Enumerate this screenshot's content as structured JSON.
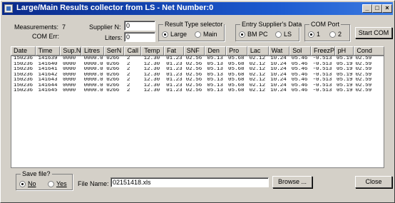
{
  "window": {
    "title": "Large/Main Results collector from LS - Net Number:0",
    "minimize_label": "_",
    "maximize_label": "□",
    "close_label": "×"
  },
  "status": {
    "measurements_label": "Measurements:",
    "measurements_value": "7",
    "com_err_label": "COM Err:"
  },
  "supplier": {
    "label": "Supplier N:",
    "value": "0"
  },
  "liters": {
    "label": "Liters:",
    "value": "0"
  },
  "result_type": {
    "title": "Result Type selector",
    "options": [
      {
        "label": "Large",
        "selected": true
      },
      {
        "label": "Main",
        "selected": false
      }
    ]
  },
  "entry_supplier": {
    "title": "Entry Supplier's Data",
    "options": [
      {
        "label": "BM PC",
        "selected": true
      },
      {
        "label": "LS",
        "selected": false
      }
    ]
  },
  "com_port": {
    "title": "COM Port",
    "options": [
      {
        "label": "1",
        "selected": true
      },
      {
        "label": "2",
        "selected": false
      }
    ]
  },
  "start_com_label": "Start COM",
  "table": {
    "columns": [
      "Date",
      "Time",
      "Sup.N:",
      "Litres",
      "SerN",
      "Call",
      "Temp",
      "Fat",
      "SNF",
      "Den",
      "Pro",
      "Lac",
      "Wat",
      "Sol",
      "FreezP",
      "pH",
      "Cond"
    ],
    "rows": [
      [
        "150236",
        "141639",
        "0000",
        "0000.0",
        "0266",
        "2",
        "12.30",
        "01.23",
        "02.56",
        "05.13",
        "05.68",
        "02.12",
        "10.24",
        "05.46",
        "-0.513",
        "05.19",
        "02.59"
      ],
      [
        "150236",
        "141640",
        "0000",
        "0000.0",
        "0266",
        "2",
        "12.30",
        "01.23",
        "02.56",
        "05.13",
        "05.68",
        "02.12",
        "10.24",
        "05.46",
        "-0.513",
        "05.19",
        "02.59"
      ],
      [
        "150236",
        "141641",
        "0000",
        "0000.0",
        "0266",
        "2",
        "12.30",
        "01.23",
        "02.56",
        "05.13",
        "05.68",
        "02.12",
        "10.24",
        "05.46",
        "-0.513",
        "05.19",
        "02.59"
      ],
      [
        "150236",
        "141642",
        "0000",
        "0000.0",
        "0266",
        "2",
        "12.30",
        "01.23",
        "02.56",
        "05.13",
        "05.68",
        "02.12",
        "10.24",
        "05.46",
        "-0.513",
        "05.19",
        "02.59"
      ],
      [
        "150236",
        "141643",
        "0000",
        "0000.0",
        "0266",
        "2",
        "12.30",
        "01.23",
        "02.56",
        "05.13",
        "05.68",
        "02.12",
        "10.24",
        "05.46",
        "-0.513",
        "05.19",
        "02.59"
      ],
      [
        "150236",
        "141644",
        "0000",
        "0000.0",
        "0266",
        "2",
        "12.30",
        "01.23",
        "02.56",
        "05.13",
        "05.68",
        "02.12",
        "10.24",
        "05.46",
        "-0.513",
        "05.19",
        "02.59"
      ],
      [
        "150236",
        "141645",
        "0000",
        "0000.0",
        "0266",
        "2",
        "12.30",
        "01.23",
        "02.56",
        "05.13",
        "05.68",
        "02.12",
        "10.24",
        "05.46",
        "-0.513",
        "05.19",
        "02.59"
      ]
    ]
  },
  "save_file": {
    "title": "Save file?",
    "options": [
      {
        "label": "No",
        "selected": true
      },
      {
        "label": "Yes",
        "selected": false
      }
    ]
  },
  "file_name": {
    "label": "File Name:",
    "value": "02151418.xls"
  },
  "browse_label": "Browse ...",
  "close_button_label": "Close"
}
